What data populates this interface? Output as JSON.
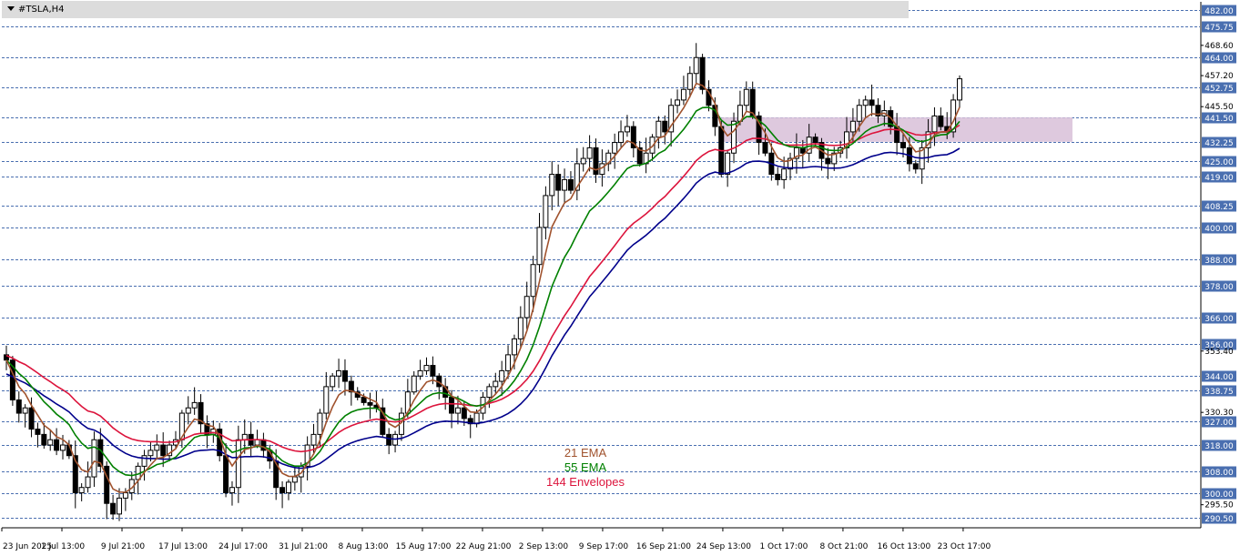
{
  "window": {
    "symbol_title": "#TSLA,H4"
  },
  "colors": {
    "ema21": "#a0522d",
    "ema55": "#008000",
    "env144_upper": "#dc143c",
    "env144_lower": "#00008b",
    "zone_fill": "#d8bfd8",
    "grid": "#4a6fb0",
    "price_box": "#4a6fb0",
    "candle": "#000000"
  },
  "chart_data": {
    "type": "candlestick",
    "symbol": "#TSLA",
    "timeframe": "H4",
    "ylim": [
      287.5,
      485
    ],
    "x_ticks": [
      "23 Jun 2025",
      "1 Jul 13:00",
      "9 Jul 21:00",
      "17 Jul 13:00",
      "24 Jul 17:00",
      "31 Jul 21:00",
      "8 Aug 13:00",
      "15 Aug 17:00",
      "22 Aug 21:00",
      "2 Sep 13:00",
      "9 Sep 17:00",
      "16 Sep 21:00",
      "24 Sep 13:00",
      "1 Oct 17:00",
      "8 Oct 21:00",
      "16 Oct 13:00",
      "23 Oct 17:00"
    ],
    "y_ticks_plain": [
      "468.60",
      "457.20",
      "445.50",
      "353.40",
      "330.30",
      "295.50"
    ],
    "highlighted_levels": [
      {
        "label": "482.00",
        "value": 482.0
      },
      {
        "label": "475.75",
        "value": 475.75
      },
      {
        "label": "464.00",
        "value": 464.0
      },
      {
        "label": "452.75",
        "value": 452.75
      },
      {
        "label": "441.50",
        "value": 441.5
      },
      {
        "label": "432.25",
        "value": 432.25
      },
      {
        "label": "425.00",
        "value": 425.0
      },
      {
        "label": "419.00",
        "value": 419.0
      },
      {
        "label": "408.25",
        "value": 408.25
      },
      {
        "label": "400.00",
        "value": 400.0
      },
      {
        "label": "388.00",
        "value": 388.0
      },
      {
        "label": "378.00",
        "value": 378.0
      },
      {
        "label": "366.00",
        "value": 366.0
      },
      {
        "label": "356.00",
        "value": 356.0
      },
      {
        "label": "344.00",
        "value": 344.0
      },
      {
        "label": "338.75",
        "value": 338.75
      },
      {
        "label": "327.00",
        "value": 327.0
      },
      {
        "label": "318.00",
        "value": 318.0
      },
      {
        "label": "308.00",
        "value": 308.0
      },
      {
        "label": "300.00",
        "value": 300.0
      },
      {
        "label": "290.50",
        "value": 290.5
      }
    ],
    "zone": {
      "low": 432.25,
      "high": 441.5,
      "from_index": 115,
      "to_index": 170
    },
    "closes": [
      350,
      335,
      330,
      332,
      324,
      322,
      318,
      320,
      316,
      318,
      314,
      300,
      302,
      306,
      320,
      310,
      296,
      292,
      298,
      300,
      305,
      310,
      314,
      316,
      318,
      314,
      318,
      320,
      330,
      332,
      334,
      326,
      322,
      324,
      314,
      300,
      302,
      320,
      322,
      318,
      320,
      316,
      312,
      302,
      300,
      304,
      306,
      310,
      318,
      322,
      330,
      340,
      344,
      346,
      342,
      338,
      336,
      334,
      333,
      332,
      322,
      318,
      322,
      330,
      338,
      344,
      346,
      348,
      344,
      340,
      336,
      330,
      332,
      328,
      326,
      330,
      336,
      340,
      342,
      346,
      352,
      358,
      366,
      374,
      386,
      400,
      412,
      420,
      414,
      418,
      414,
      424,
      426,
      430,
      420,
      424,
      428,
      432,
      436,
      438,
      430,
      424,
      428,
      434,
      440,
      436,
      446,
      448,
      452,
      458,
      464,
      452,
      446,
      438,
      420,
      428,
      440,
      446,
      452,
      442,
      432,
      428,
      420,
      418,
      422,
      426,
      430,
      428,
      434,
      432,
      426,
      424,
      428,
      430,
      436,
      440,
      446,
      448,
      446,
      442,
      444,
      438,
      432,
      430,
      424,
      422,
      430,
      436,
      442,
      438,
      436,
      448,
      456
    ],
    "series": [
      {
        "name": "21 EMA"
      },
      {
        "name": "55 EMA"
      },
      {
        "name": "144 Envelopes"
      }
    ]
  },
  "legend": {
    "ema21": "21 EMA",
    "ema55": "55 EMA",
    "env144": "144 Envelopes"
  }
}
